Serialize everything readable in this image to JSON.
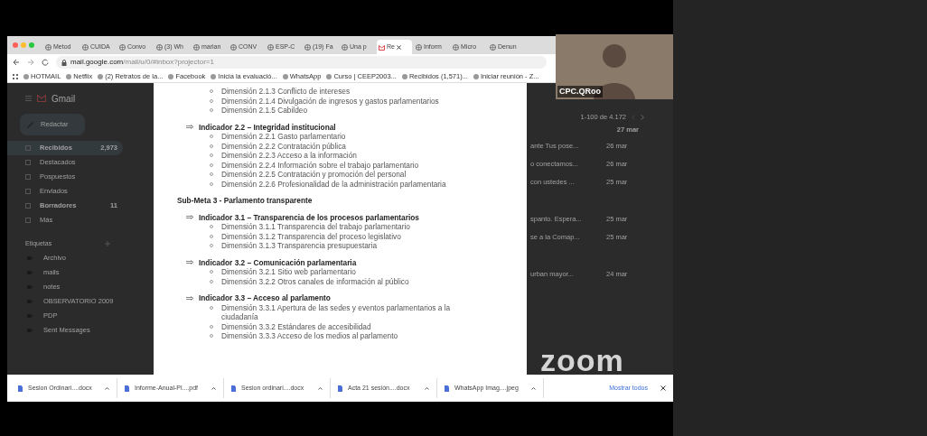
{
  "meeting": {
    "participant_name": "CPC.QRoo",
    "logo": "zoom"
  },
  "browser": {
    "tabs": [
      {
        "label": "Metod",
        "selected": false
      },
      {
        "label": "CUIDA",
        "selected": false
      },
      {
        "label": "Convo",
        "selected": false
      },
      {
        "label": "(3) Wh",
        "selected": false
      },
      {
        "label": "marian",
        "selected": false
      },
      {
        "label": "CONV",
        "selected": false
      },
      {
        "label": "ESP-C",
        "selected": false
      },
      {
        "label": "(19) Fa",
        "selected": false
      },
      {
        "label": "Una p",
        "selected": false
      },
      {
        "label": "Re",
        "selected": true
      },
      {
        "label": "Inform",
        "selected": false
      },
      {
        "label": "Micro",
        "selected": false
      },
      {
        "label": "Denun",
        "selected": false
      }
    ],
    "url_host": "mail.google.com",
    "url_path": "/mail/u/0/#inbox?projector=1",
    "bookmarks": [
      "HOTMAIL",
      "Netflix",
      "(2) Retratos de la...",
      "Facebook",
      "Inicia la evaluació...",
      "WhatsApp",
      "Curso | CEEP2003...",
      "Recibidos (1,571)...",
      "Iniciar reunión - Z..."
    ]
  },
  "gmail": {
    "brand": "Gmail",
    "compose": "Redactar",
    "nav": [
      {
        "label": "Recibidos",
        "count": "2,973",
        "selected": true,
        "unread": true
      },
      {
        "label": "Destacados",
        "selected": false,
        "unread": false
      },
      {
        "label": "Pospuestos",
        "selected": false,
        "unread": false
      },
      {
        "label": "Enviados",
        "selected": false,
        "unread": false
      },
      {
        "label": "Borradores",
        "count": "11",
        "selected": false,
        "unread": true
      },
      {
        "label": "Más",
        "selected": false,
        "unread": false
      }
    ],
    "labels_heading": "Etiquetas",
    "labels": [
      "Archivo",
      "mails",
      "notes",
      "OBSERVATORIO 2009",
      "PDP",
      "Sent Messages"
    ],
    "pagination": "1-100 de 4.172",
    "header_date": "27 mar",
    "messages": [
      {
        "snippet": "ante Tus pose...",
        "date": "26 mar"
      },
      {
        "snippet": "o conectamos...",
        "date": "26 mar"
      },
      {
        "snippet": "con ustedes ...",
        "date": "25 mar"
      },
      {
        "snippet": "spanto. Espera...",
        "date": "25 mar"
      },
      {
        "snippet": "se a la Comap...",
        "date": "25 mar"
      },
      {
        "snippet": "urban mayor...",
        "date": "24 mar"
      }
    ]
  },
  "document": {
    "lines": [
      {
        "kind": "dimension",
        "text": "Dimensión 2.1.3 Conflicto de intereses"
      },
      {
        "kind": "dimension",
        "text": "Dimensión 2.1.4 Divulgación de ingresos y gastos parlamentarios"
      },
      {
        "kind": "dimension",
        "text": "Dimensión 2.1.5 Cabildeo"
      },
      {
        "kind": "indicator",
        "text": "Indicador 2.2 – Integridad institucional"
      },
      {
        "kind": "dimension",
        "text": "Dimensión 2.2.1 Gasto parlamentario"
      },
      {
        "kind": "dimension",
        "text": "Dimensión 2.2.2 Contratación pública"
      },
      {
        "kind": "dimension",
        "text": "Dimensión 2.2.3 Acceso a la información"
      },
      {
        "kind": "dimension",
        "text": "Dimensión 2.2.4 Información sobre el trabajo parlamentario"
      },
      {
        "kind": "dimension",
        "text": "Dimensión 2.2.5 Contratación y promoción del personal"
      },
      {
        "kind": "dimension",
        "text": "Dimensión 2.2.6 Profesionalidad de la administración parlamentaria"
      },
      {
        "kind": "heading",
        "text": "Sub-Meta 3 - Parlamento transparente"
      },
      {
        "kind": "indicator",
        "text": "Indicador 3.1 – Transparencia de los procesos parlamentarios"
      },
      {
        "kind": "dimension",
        "text": "Dimensión 3.1.1 Transparencia del trabajo parlamentario"
      },
      {
        "kind": "dimension",
        "text": "Dimensión 3.1.2 Transparencia del proceso legislativo"
      },
      {
        "kind": "dimension",
        "text": "Dimensión 3.1.3 Transparencia presupuestaria"
      },
      {
        "kind": "indicator",
        "text": "Indicador 3.2 – Comunicación parlamentaria"
      },
      {
        "kind": "dimension",
        "text": "Dimensión 3.2.1 Sitio web parlamentario"
      },
      {
        "kind": "dimension",
        "text": "Dimensión 3.2.2 Otros canales de información al público"
      },
      {
        "kind": "indicator",
        "text": "Indicador 3.3 – Acceso al parlamento"
      },
      {
        "kind": "dimension",
        "text": "Dimensión 3.3.1 Apertura de las sedes y eventos parlamentarios a la ciudadanía"
      },
      {
        "kind": "dimension",
        "text": "Dimensión 3.3.2 Estándares de accesibilidad"
      },
      {
        "kind": "dimension",
        "text": "Dimensión 3.3.3 Acceso de los medios al parlamento"
      }
    ]
  },
  "downloads": {
    "items": [
      "Sesion Ordinari....docx",
      "Informe-Anual-Pl....pdf",
      "Sesion ordinari....docx",
      "Acta 21 sesión....docx",
      "WhatsApp Imag....jpeg"
    ],
    "show_all": "Mostrar todos"
  }
}
